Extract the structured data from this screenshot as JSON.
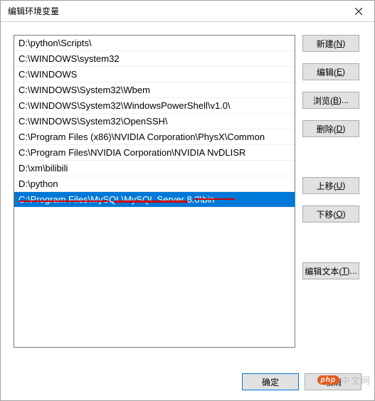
{
  "window": {
    "title": "编辑环境变量"
  },
  "list": {
    "items": [
      "D:\\python\\Scripts\\",
      "C:\\WINDOWS\\system32",
      "C:\\WINDOWS",
      "C:\\WINDOWS\\System32\\Wbem",
      "C:\\WINDOWS\\System32\\WindowsPowerShell\\v1.0\\",
      "C:\\WINDOWS\\System32\\OpenSSH\\",
      "C:\\Program Files (x86)\\NVIDIA Corporation\\PhysX\\Common",
      "C:\\Program Files\\NVIDIA Corporation\\NVIDIA NvDLISR",
      "D:\\xm\\bilibili",
      "D:\\python",
      "C:\\Program Files\\MySQL\\MySQL Server 8.0\\bin"
    ],
    "selected_index": 10
  },
  "buttons": {
    "new_label": "新建(",
    "new_key": "N",
    "edit_label": "编辑(",
    "edit_key": "E",
    "browse_label": "浏览(",
    "browse_key": "B",
    "browse_suffix": ")...",
    "delete_label": "删除(",
    "delete_key": "D",
    "moveup_label": "上移(",
    "moveup_key": "U",
    "movedown_label": "下移(",
    "movedown_key": "O",
    "edittext_label": "编辑文本(",
    "edittext_key": "T",
    "edittext_suffix": ")...",
    "close_paren": ")"
  },
  "footer": {
    "ok_label": "确定",
    "cancel_label": "取消"
  },
  "watermark": {
    "pill": "php",
    "text": "中文网"
  }
}
